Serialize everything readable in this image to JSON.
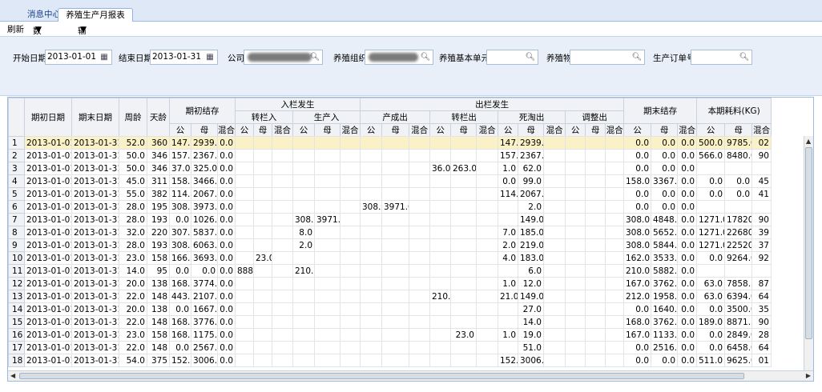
{
  "tabs": [
    {
      "label": "消息中心"
    },
    {
      "label": "养殖生产月报表"
    }
  ],
  "menu": {
    "refresh": "刷新",
    "data_process": "数据处理",
    "output": "输出"
  },
  "filters": {
    "start_label": "开始日期",
    "start_value": "2013-01-01",
    "end_label": "结束日期",
    "end_value": "2013-01-31",
    "company_label": "公司",
    "org_label": "养殖组织",
    "unit_label": "养殖基本单元",
    "object_label": "养殖物",
    "order_label": "生产订单号"
  },
  "header": {
    "start_date": "期初日期",
    "end_date": "期末日期",
    "week_age": "周龄",
    "day_age": "天龄",
    "opening": "期初结存",
    "stock_in": "入栏发生",
    "transfer_in": "转栏入",
    "production_in": "生产入",
    "stock_out": "出栏发生",
    "production_out": "产成出",
    "transfer_out": "转栏出",
    "death_out": "死淘出",
    "adjust_out": "调整出",
    "closing": "期末结存",
    "consumption": "本期耗料(KG)",
    "male": "公",
    "female": "母",
    "mixed": "混合",
    "total_short": "合"
  },
  "rows": [
    {
      "n": "1",
      "s": "2013-01-01",
      "e": "2013-01-31",
      "w": "52.0",
      "d": "360",
      "om": "147.0",
      "of": "2939.0",
      "ox": "0.0",
      "dm": "147.0",
      "df": "2939.0",
      "cm": "0.0",
      "cf": "0.0",
      "cx": "0.0",
      "fm": "500.0",
      "ff": "9785.0",
      "ft": "02"
    },
    {
      "n": "2",
      "s": "2013-01-01",
      "e": "2013-01-31",
      "w": "50.0",
      "d": "346",
      "om": "157.0",
      "of": "2367.0",
      "ox": "0.0",
      "dm": "157.0",
      "df": "2367.0",
      "cm": "0.0",
      "cf": "0.0",
      "cx": "0.0",
      "fm": "566.0",
      "ff": "8480.0",
      "ft": "90"
    },
    {
      "n": "3",
      "s": "2013-01-01",
      "e": "2013-01-31",
      "w": "50.0",
      "d": "346",
      "om": "37.0",
      "of": "325.0",
      "ox": "0.0",
      "tom": "36.0",
      "tof": "263.0",
      "dm": "1.0",
      "df": "62.0",
      "cm": "0.0",
      "cf": "0.0",
      "cx": "0.0"
    },
    {
      "n": "4",
      "s": "2013-01-01",
      "e": "2013-01-31",
      "w": "45.0",
      "d": "311",
      "om": "158.0",
      "of": "3466.0",
      "ox": "0.0",
      "dm": "0.0",
      "df": "99.0",
      "cm": "158.0",
      "cf": "3367.0",
      "cx": "0.0",
      "fm": "0.0",
      "ff": "0.0",
      "ft": "45"
    },
    {
      "n": "5",
      "s": "2013-01-01",
      "e": "2013-01-31",
      "w": "55.0",
      "d": "382",
      "om": "114.0",
      "of": "2067.0",
      "ox": "0.0",
      "dm": "114.0",
      "df": "2067.0",
      "cm": "0.0",
      "cf": "0.0",
      "cx": "0.0",
      "fm": "0.0",
      "ff": "0.0",
      "ft": "41"
    },
    {
      "n": "6",
      "s": "2013-01-01",
      "e": "2013-01-31",
      "w": "28.0",
      "d": "195",
      "om": "308.0",
      "of": "3973.0",
      "ox": "0.0",
      "pom": "308.0",
      "pof": "3971.0",
      "df": "2.0",
      "cm": "0.0",
      "cf": "0.0",
      "cx": "0.0"
    },
    {
      "n": "7",
      "s": "2013-01-01",
      "e": "2013-01-31",
      "w": "28.0",
      "d": "193",
      "om": "0.0",
      "of": "1026.0",
      "ox": "0.0",
      "pim": "308.0",
      "pif": "3971.0",
      "df": "149.0",
      "cm": "308.0",
      "cf": "4848.0",
      "cx": "0.0",
      "fm": "1271.0",
      "ff": "17820.0",
      "ft": "90"
    },
    {
      "n": "8",
      "s": "2013-01-01",
      "e": "2013-01-31",
      "w": "32.0",
      "d": "220",
      "om": "307.0",
      "of": "5837.0",
      "ox": "0.0",
      "pim": "8.0",
      "dm": "7.0",
      "df": "185.0",
      "cm": "308.0",
      "cf": "5652.0",
      "cx": "0.0",
      "fm": "1271.0",
      "ff": "22680.0",
      "ft": "39"
    },
    {
      "n": "9",
      "s": "2013-01-01",
      "e": "2013-01-31",
      "w": "28.0",
      "d": "193",
      "om": "308.0",
      "of": "6063.0",
      "ox": "0.0",
      "pim": "2.0",
      "dm": "2.0",
      "df": "219.0",
      "cm": "308.0",
      "cf": "5844.0",
      "cx": "0.0",
      "fm": "1271.0",
      "ff": "22520.0",
      "ft": "37"
    },
    {
      "n": "10",
      "s": "2013-01-01",
      "e": "2013-01-31",
      "w": "23.0",
      "d": "158",
      "om": "166.0",
      "of": "3693.0",
      "ox": "0.0",
      "tif": "23.0",
      "dm": "4.0",
      "df": "183.0",
      "cm": "162.0",
      "cf": "3533.0",
      "cx": "0.0",
      "fm": "0.0",
      "ff": "9264.0",
      "ft": "92"
    },
    {
      "n": "11",
      "s": "2013-01-01",
      "e": "2013-01-31",
      "w": "14.0",
      "d": "95",
      "om": "0.0",
      "of": "0.0",
      "ox": "0.0",
      "tim": "888.0",
      "pim": "210.0",
      "df": "6.0",
      "cm": "210.0",
      "cf": "5882.0",
      "cx": "0.0"
    },
    {
      "n": "12",
      "s": "2013-01-01",
      "e": "2013-01-31",
      "w": "20.0",
      "d": "138",
      "om": "168.0",
      "of": "3774.0",
      "ox": "0.0",
      "dm": "1.0",
      "df": "12.0",
      "cm": "167.0",
      "cf": "3762.0",
      "cx": "0.0",
      "fm": "63.0",
      "ff": "7858.5",
      "ft": "87"
    },
    {
      "n": "13",
      "s": "2013-01-01",
      "e": "2013-01-31",
      "w": "22.0",
      "d": "148",
      "om": "443.0",
      "of": "2107.0",
      "ox": "0.0",
      "tom": "210.0",
      "dm": "21.0",
      "df": "149.0",
      "cm": "212.0",
      "cf": "1958.0",
      "cx": "0.0",
      "fm": "63.0",
      "ff": "6394.0",
      "ft": "64"
    },
    {
      "n": "14",
      "s": "2013-01-01",
      "e": "2013-01-31",
      "w": "20.0",
      "d": "138",
      "om": "0.0",
      "of": "1667.0",
      "ox": "0.0",
      "df": "27.0",
      "cm": "0.0",
      "cf": "1640.0",
      "cx": "0.0",
      "fm": "0.0",
      "ff": "3500.0",
      "ft": "35"
    },
    {
      "n": "15",
      "s": "2013-01-01",
      "e": "2013-01-31",
      "w": "22.0",
      "d": "148",
      "om": "168.0",
      "of": "3776.0",
      "ox": "0.0",
      "df": "14.0",
      "cm": "168.0",
      "cf": "3762.0",
      "cx": "0.0",
      "fm": "189.0",
      "ff": "8871.5",
      "ft": "90"
    },
    {
      "n": "16",
      "s": "2013-01-01",
      "e": "2013-01-31",
      "w": "23.0",
      "d": "158",
      "om": "168.0",
      "of": "1175.0",
      "ox": "0.0",
      "tof": "23.0",
      "dm": "1.0",
      "df": "19.0",
      "cm": "167.0",
      "cf": "1133.0",
      "cx": "0.0",
      "fm": "0.0",
      "ff": "2849.0",
      "ft": "28"
    },
    {
      "n": "17",
      "s": "2013-01-01",
      "e": "2013-01-31",
      "w": "22.0",
      "d": "148",
      "om": "0.0",
      "of": "2567.0",
      "ox": "0.0",
      "df": "51.0",
      "cm": "0.0",
      "cf": "2516.0",
      "cx": "0.0",
      "fm": "0.0",
      "ff": "6458.0",
      "ft": "64"
    },
    {
      "n": "18",
      "s": "2013-01-01",
      "e": "2013-01-31",
      "w": "54.0",
      "d": "375",
      "om": "152.0",
      "of": "3006.0",
      "ox": "0.0",
      "dm": "152.0",
      "df": "3006.0",
      "cm": "0.0",
      "cf": "0.0",
      "cx": "0.0",
      "fm": "511.0",
      "ff": "9625.0",
      "ft": "01"
    }
  ]
}
